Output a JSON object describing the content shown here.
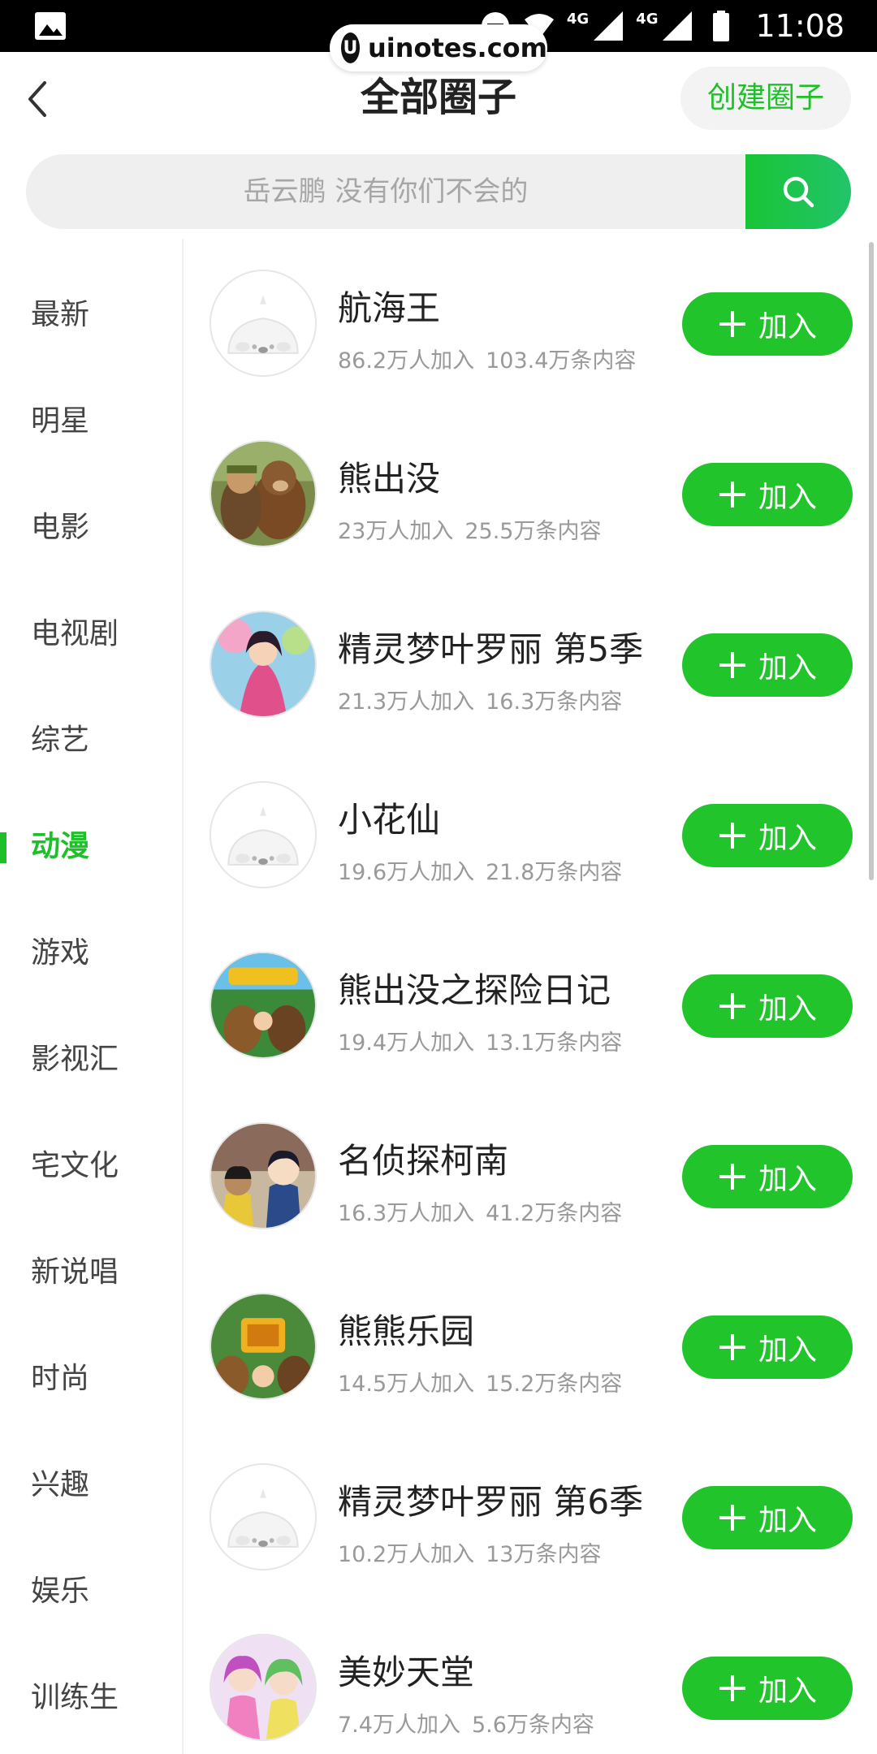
{
  "status_bar": {
    "time": "11:08",
    "network_1": "4G",
    "network_2": "4G"
  },
  "watermark": {
    "logo": "U",
    "text": "uinotes.com"
  },
  "header": {
    "title": "全部圈子",
    "create_label": "创建圈子"
  },
  "search": {
    "placeholder": "岳云鹏 没有你们不会的"
  },
  "sidebar": {
    "active": "动漫",
    "items": [
      {
        "label": "最新"
      },
      {
        "label": "明星"
      },
      {
        "label": "电影"
      },
      {
        "label": "电视剧"
      },
      {
        "label": "综艺"
      },
      {
        "label": "动漫"
      },
      {
        "label": "游戏"
      },
      {
        "label": "影视汇"
      },
      {
        "label": "宅文化"
      },
      {
        "label": "新说唱"
      },
      {
        "label": "时尚"
      },
      {
        "label": "兴趣"
      },
      {
        "label": "娱乐"
      },
      {
        "label": "训练生"
      }
    ]
  },
  "join_label": "加入",
  "circles": [
    {
      "title": "航海王",
      "members": "86.2万人加入",
      "posts": "103.4万条内容",
      "avatar": "placeholder-seal"
    },
    {
      "title": "熊出没",
      "members": "23万人加入",
      "posts": "25.5万条内容",
      "avatar": "bears-cartoon"
    },
    {
      "title": "精灵梦叶罗丽 第5季",
      "members": "21.3万人加入",
      "posts": "16.3万条内容",
      "avatar": "fairy-girl"
    },
    {
      "title": "小花仙",
      "members": "19.6万人加入",
      "posts": "21.8万条内容",
      "avatar": "placeholder-seal"
    },
    {
      "title": "熊出没之探险日记",
      "members": "19.4万人加入",
      "posts": "13.1万条内容",
      "avatar": "bears-adventure"
    },
    {
      "title": "名侦探柯南",
      "members": "16.3万人加入",
      "posts": "41.2万条内容",
      "avatar": "detective-boy"
    },
    {
      "title": "熊熊乐园",
      "members": "14.5万人加入",
      "posts": "15.2万条内容",
      "avatar": "bears-park"
    },
    {
      "title": "精灵梦叶罗丽 第6季",
      "members": "10.2万人加入",
      "posts": "13万条内容",
      "avatar": "placeholder-seal"
    },
    {
      "title": "美妙天堂",
      "members": "7.4万人加入",
      "posts": "5.6万条内容",
      "avatar": "idol-girls"
    }
  ],
  "colors": {
    "accent": "#21c42a",
    "title_text": "#222222",
    "meta_text": "#999999"
  }
}
